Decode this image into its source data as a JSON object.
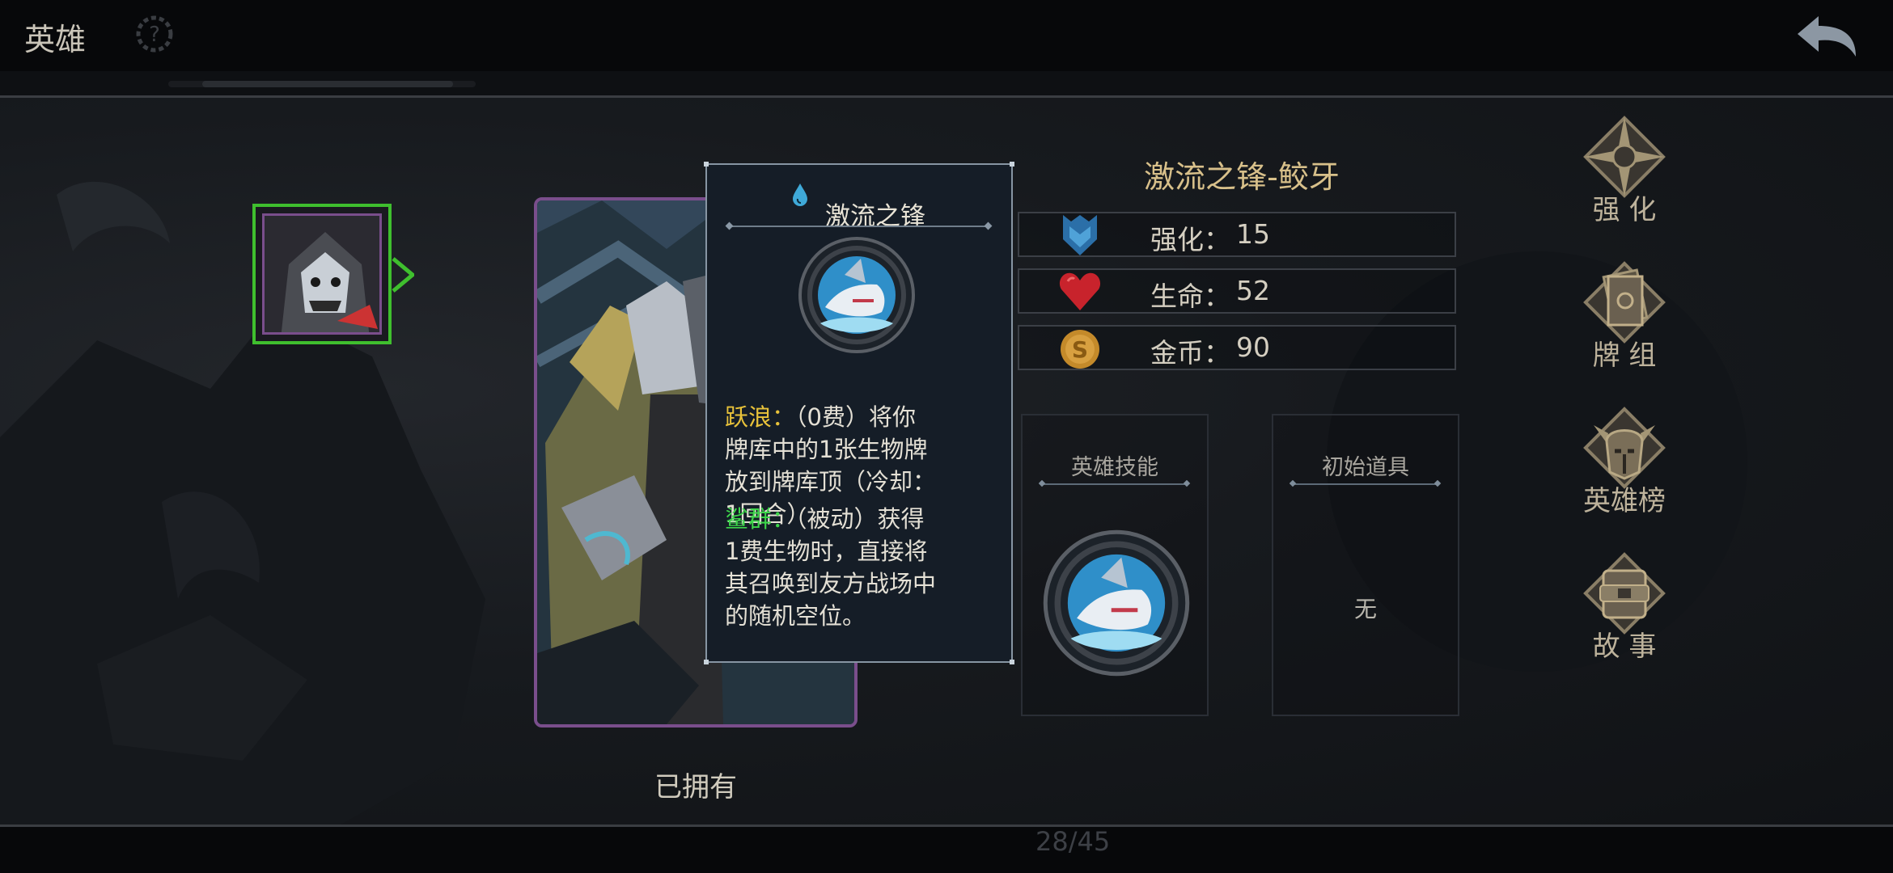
{
  "header": {
    "title": "英雄",
    "back_icon": "back-arrow-icon",
    "help_icon": "help-gear-icon"
  },
  "hero": {
    "name": "激流之锋-鲛牙",
    "status": "已拥有"
  },
  "tooltip": {
    "title": "激流之锋",
    "title_icon": "water-drop-icon",
    "ability1_name": "跃浪：",
    "ability1_line1": "（0费）将你",
    "ability1_line2": "牌库中的1张生物牌",
    "ability1_line3": "放到牌库顶（冷却：",
    "ability1_line4": "1回合）",
    "ability2_name": "鲨群：",
    "ability2_line1": "（被动）获得",
    "ability2_line2": "1费生物时，直接将",
    "ability2_line3": "其召唤到友方战场中",
    "ability2_line4": "的随机空位。"
  },
  "stats": [
    {
      "label": "强化：",
      "value": "15",
      "icon": "upgrade-shield-icon"
    },
    {
      "label": "生命：",
      "value": "52",
      "icon": "heart-icon"
    },
    {
      "label": "金币：",
      "value": "90",
      "icon": "gold-coin-icon"
    }
  ],
  "skill_box": {
    "title": "英雄技能"
  },
  "item_box": {
    "title": "初始道具",
    "value": "无"
  },
  "menu": [
    {
      "label": "强 化",
      "icon": "compass-star-icon"
    },
    {
      "label": "牌 组",
      "icon": "card-deck-icon"
    },
    {
      "label": "英雄榜",
      "icon": "horned-helmet-icon"
    },
    {
      "label": "故 事",
      "icon": "story-scroll-icon"
    }
  ],
  "footer": {
    "page_counter": "28/45"
  },
  "colors": {
    "accent_gold": "#d8c08a",
    "select_green": "#3fbf2e",
    "card_purple": "#7a4e8c",
    "ability_yellow": "#e8c23a",
    "ability_green": "#3dd64a"
  }
}
